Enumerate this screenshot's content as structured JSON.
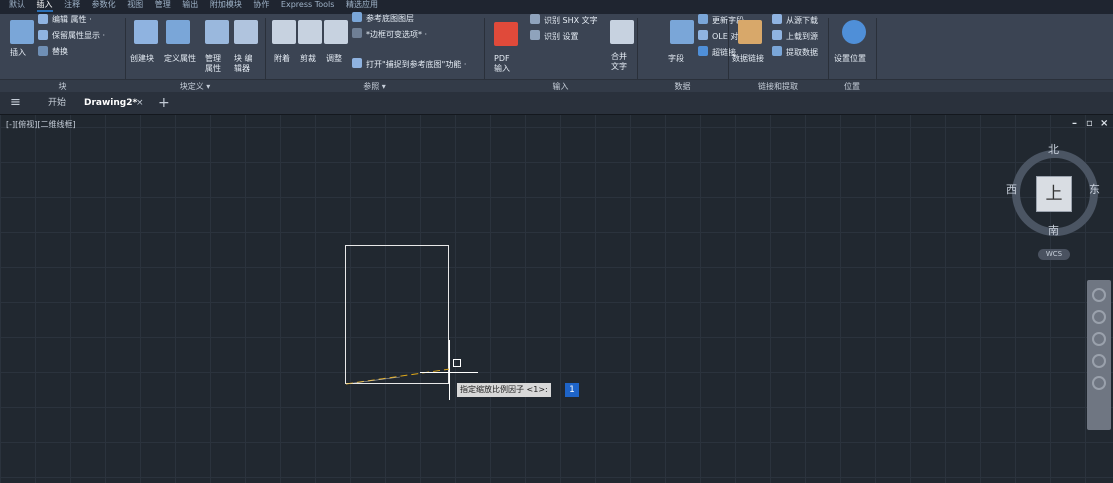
{
  "menu": [
    "默认",
    "插入",
    "注释",
    "参数化",
    "视图",
    "管理",
    "输出",
    "附加模块",
    "协作",
    "Express Tools",
    "精选应用"
  ],
  "menu_active": "插入",
  "ribbon": {
    "block": {
      "insert": "插入",
      "edit_attr": "编辑 属性 ·",
      "retain_attr": "保留属性显示 ·",
      "replace": "替换",
      "label": "块"
    },
    "block_def": {
      "create": "创建块",
      "define_attr": "定义属性",
      "manage_attr": "管理 属性",
      "block_editor": "块 编辑器",
      "label": "块定义 ▾"
    },
    "reference": {
      "attach": "附着",
      "clip": "剪裁",
      "adjust": "调整",
      "underlay_layers": "参考底图图层",
      "frame_var": "*边框可变选项* ·",
      "snap_underlay": "打开\"捕捉到参考底图\"功能 ·",
      "label": "参照 ▾"
    },
    "import": {
      "pdf_import": "PDF 输入",
      "recognize_shx": "识别 SHX 文字",
      "recognize_settings": "识别 设置",
      "combine_text": "合并 文字",
      "label": "输入"
    },
    "data": {
      "field": "字段",
      "update_fields": "更新字段",
      "ole_object": "OLE 对象",
      "hyperlink": "超链接",
      "label": "数据"
    },
    "linking": {
      "data_link": "数据链接",
      "download_source": "从源下载",
      "upload_source": "上载到源",
      "extract_data": "提取数据",
      "label": "链接和提取"
    },
    "location": {
      "set_location": "设置位置",
      "label": "位置"
    }
  },
  "tabs": {
    "start": "开始",
    "drawing": "Drawing2*"
  },
  "viewport": {
    "label": "[-][俯视][二维线框]"
  },
  "viewcube": {
    "north": "北",
    "south": "南",
    "east": "东",
    "west": "西",
    "top": "上",
    "wcs": "WCS"
  },
  "command": {
    "prompt": "指定缩放比例因子 <1>:",
    "input": "1"
  },
  "colors": {
    "accent": "#1e64c8",
    "background": "#212830",
    "ribbon": "#3b4453"
  }
}
